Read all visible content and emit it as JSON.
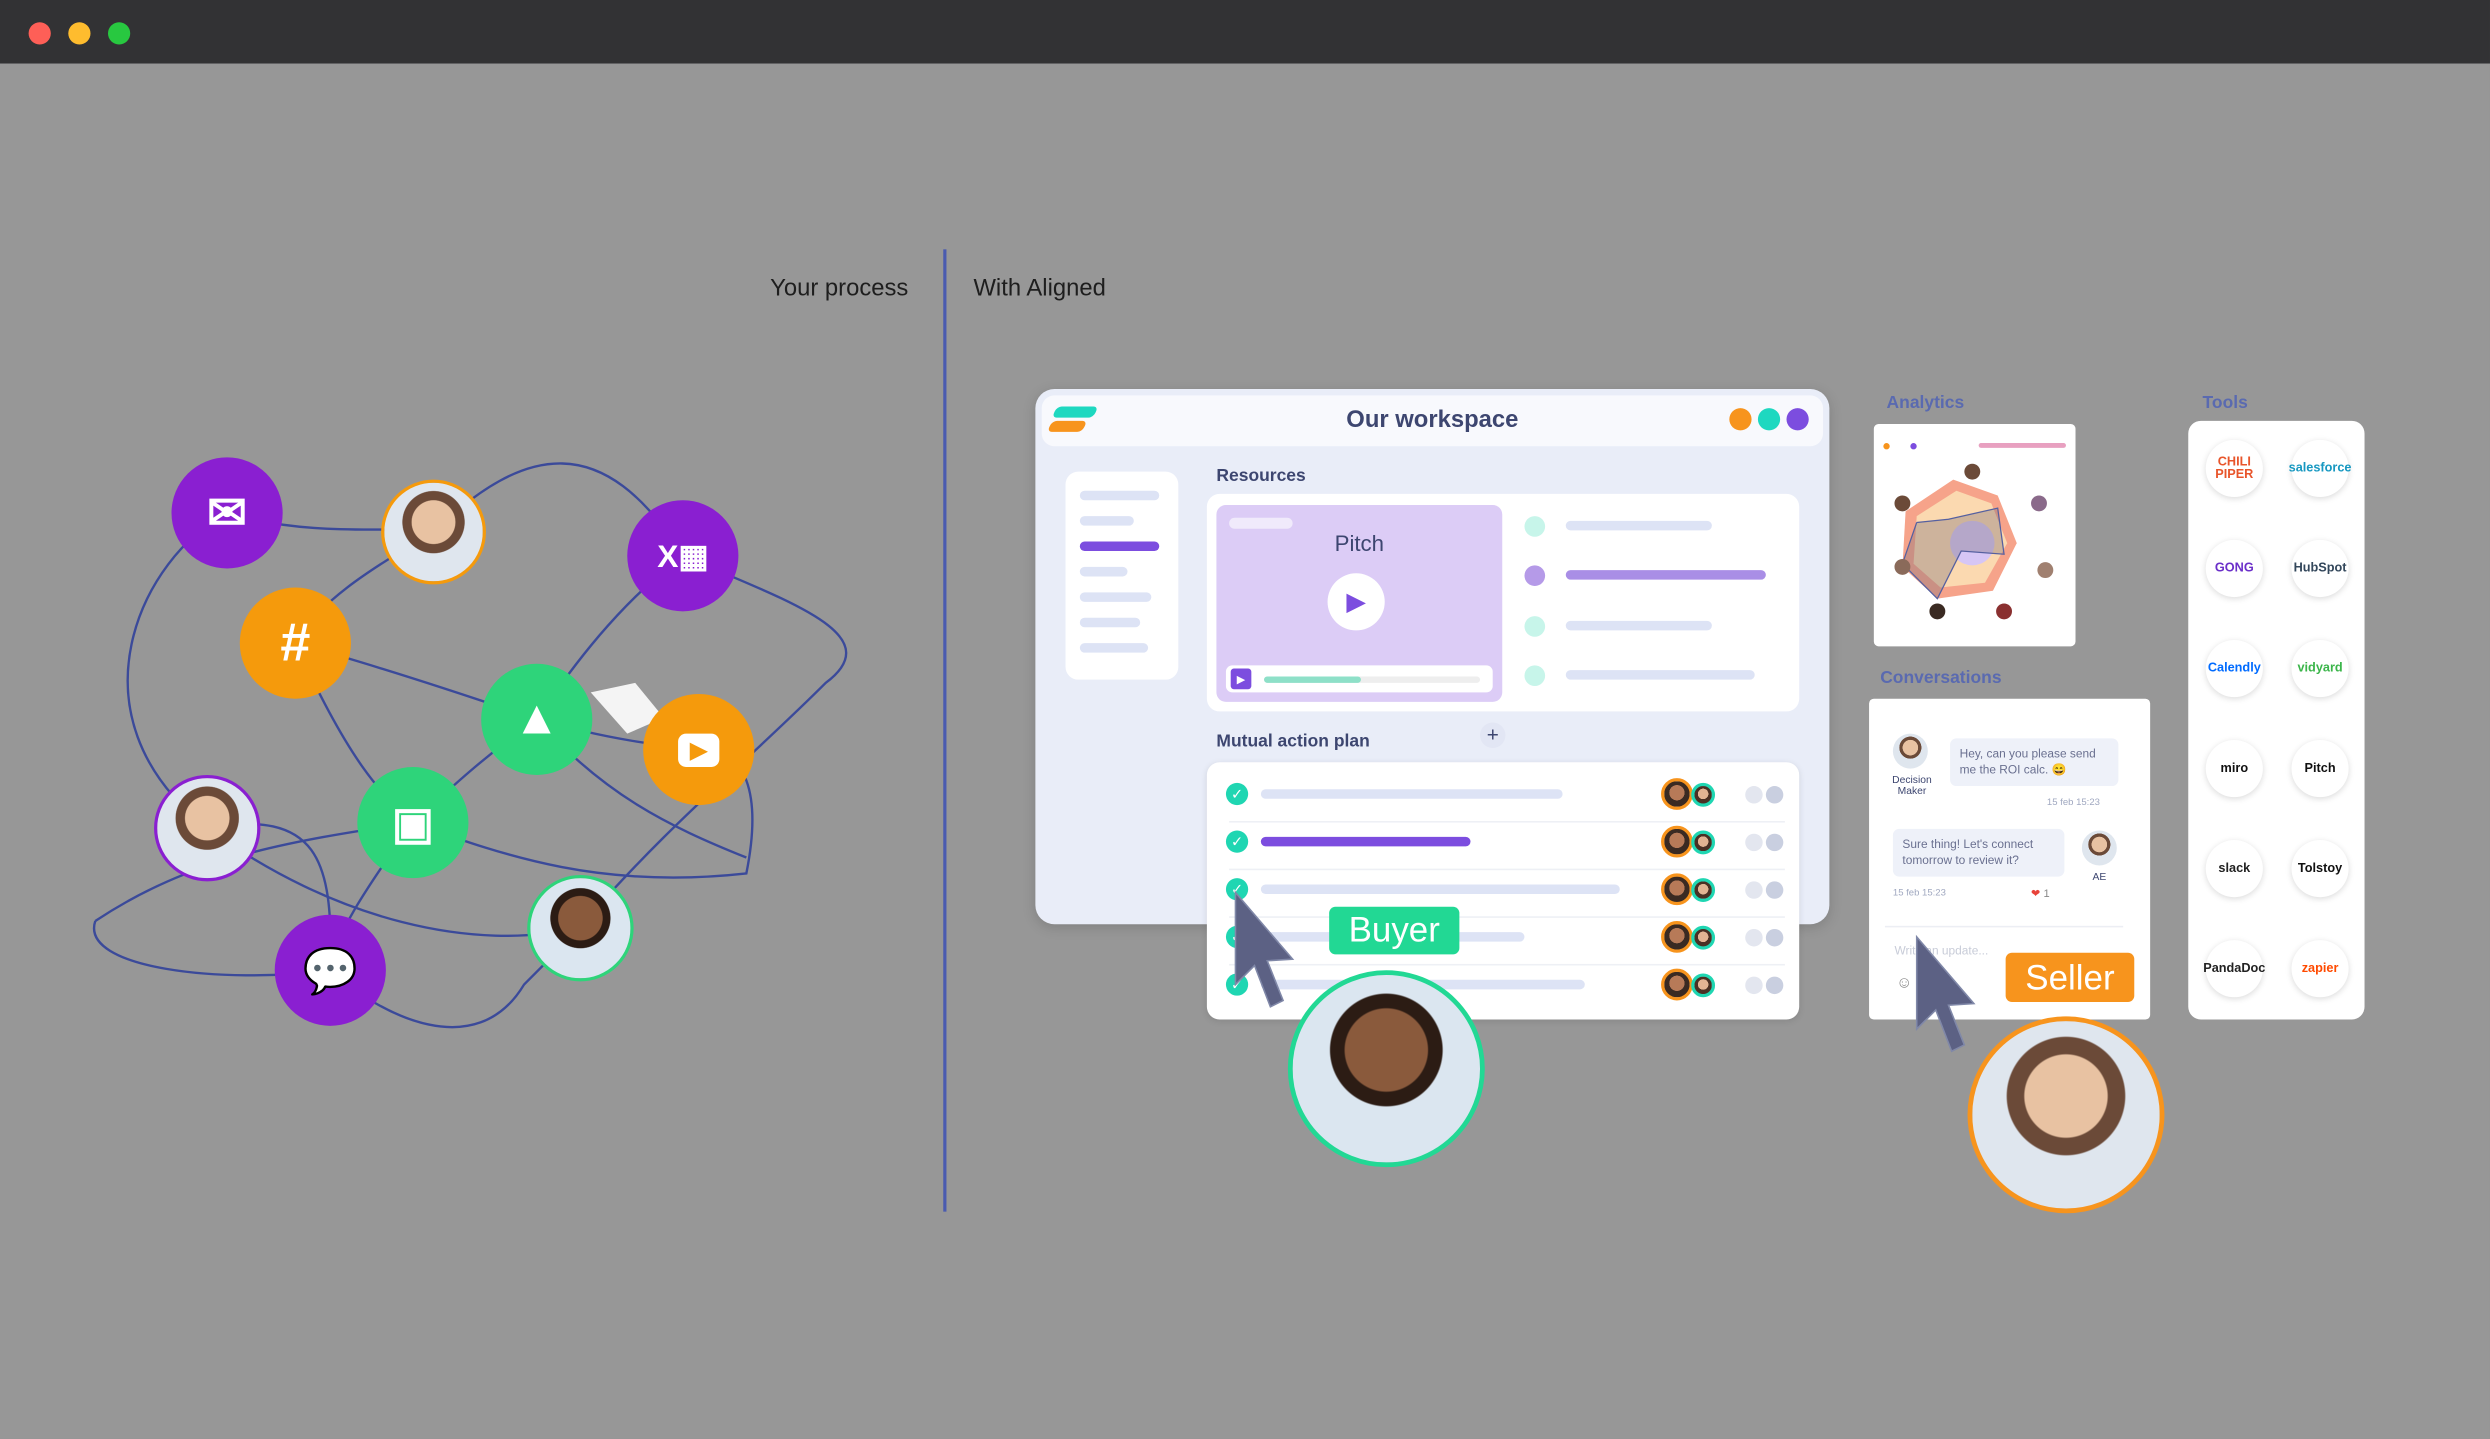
{
  "window": {
    "controls": [
      "close",
      "minimize",
      "maximize"
    ],
    "colors": {
      "close": "#fe5f57",
      "minimize": "#febc2e",
      "maximize": "#28c840"
    }
  },
  "headings": {
    "left": "Your process",
    "right": "With Aligned"
  },
  "process_nodes": [
    {
      "icon": "mail-icon",
      "color": "#8a1fd1"
    },
    {
      "icon": "excel-icon",
      "color": "#8a1fd1"
    },
    {
      "icon": "slack-icon",
      "color": "#f59a0c"
    },
    {
      "icon": "google-drive-icon",
      "color": "#2ed47a"
    },
    {
      "icon": "youtube-icon",
      "color": "#f59a0c"
    },
    {
      "icon": "google-sheets-icon",
      "color": "#2ed47a"
    },
    {
      "icon": "chat-icon",
      "color": "#8a1fd1"
    }
  ],
  "workspace": {
    "title": "Our workspace",
    "dot_colors": [
      "#f7941d",
      "#1ed8c0",
      "#7c4ddf"
    ],
    "resources_label": "Resources",
    "video_title": "Pitch",
    "video_progress": 0.45,
    "map_label": "Mutual action plan",
    "add_label": "+",
    "map_rows": 5
  },
  "buyer": {
    "label": "Buyer",
    "color": "#22d894"
  },
  "seller": {
    "label": "Seller",
    "color": "#f7941d"
  },
  "analytics": {
    "label": "Analytics"
  },
  "conversations": {
    "label": "Conversations",
    "messages": [
      {
        "author": "Decision Maker",
        "text": "Hey, can you please send me the ROI calc. 😄",
        "time": "15 feb 15:23"
      },
      {
        "author": "AE",
        "text": "Sure thing! Let's connect tomorrow to review it?",
        "time": "15 feb 15:23",
        "reactions": "1"
      }
    ],
    "input_placeholder": "Write an update..."
  },
  "tools": {
    "label": "Tools",
    "items": [
      {
        "name": "CHILI PIPER",
        "color": "#e8552b"
      },
      {
        "name": "salesforce",
        "color": "#1798c1"
      },
      {
        "name": "GONG",
        "color": "#6b2fc9"
      },
      {
        "name": "HubSpot",
        "color": "#33475b"
      },
      {
        "name": "Calendly",
        "color": "#006bff"
      },
      {
        "name": "vidyard",
        "color": "#3bb54a"
      },
      {
        "name": "miro",
        "color": "#111111"
      },
      {
        "name": "Pitch",
        "color": "#111111"
      },
      {
        "name": "slack",
        "color": "#222222"
      },
      {
        "name": "Tolstoy",
        "color": "#111111"
      },
      {
        "name": "PandaDoc",
        "color": "#222222"
      },
      {
        "name": "zapier",
        "color": "#ff4a00"
      }
    ]
  }
}
